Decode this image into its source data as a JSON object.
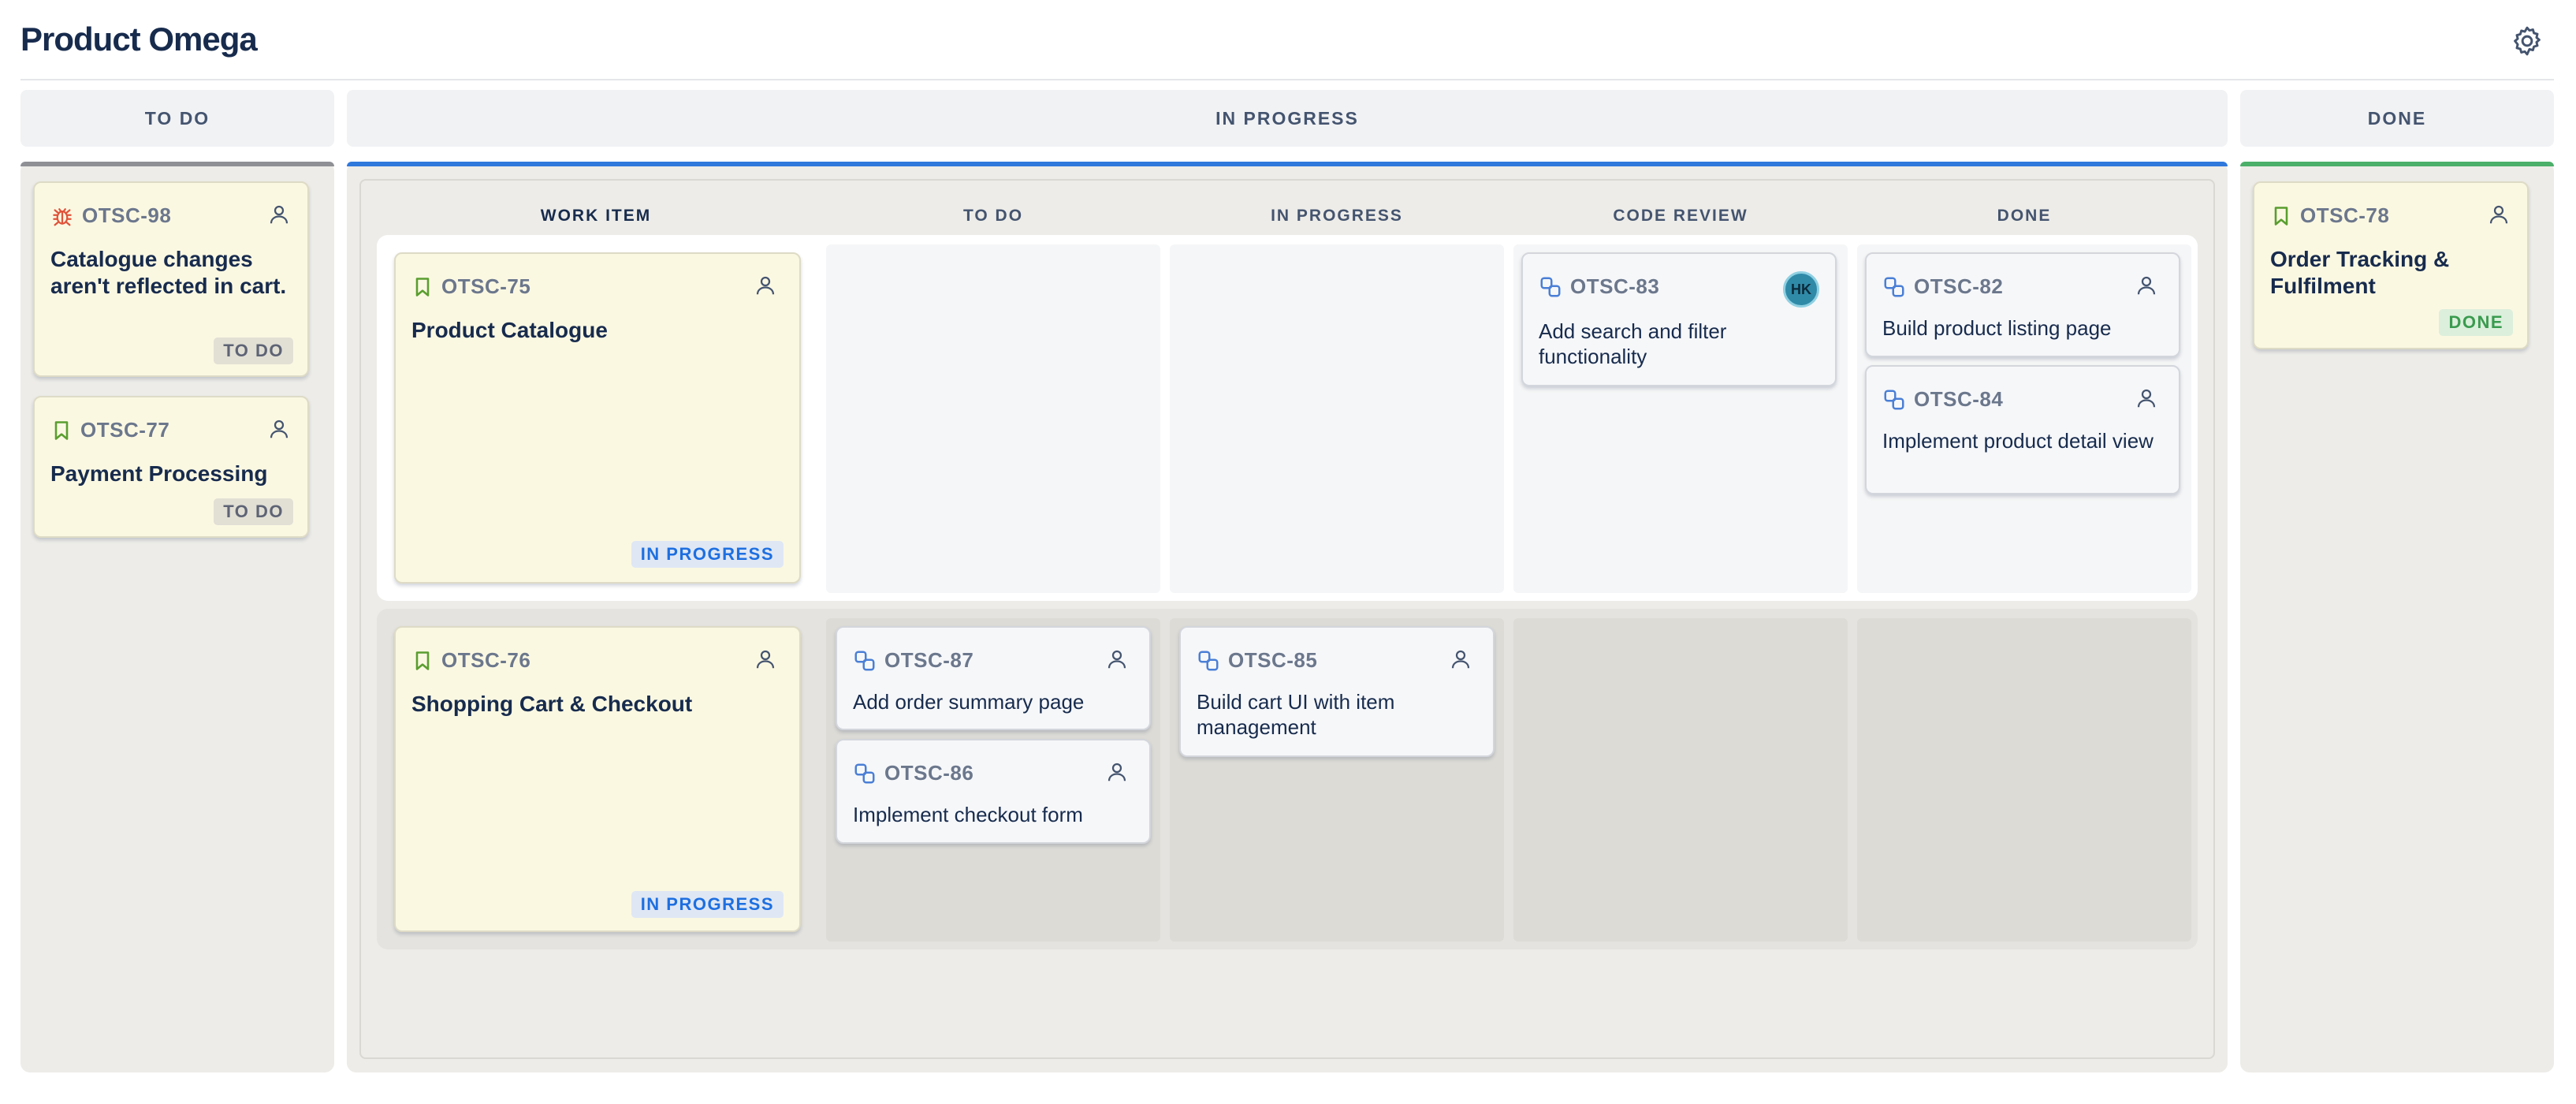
{
  "header": {
    "project_title": "Product Omega",
    "settings_icon": "gear-icon"
  },
  "columns": {
    "todo": {
      "label": "TO DO",
      "accent": "#8f9096"
    },
    "in_progress": {
      "label": "IN PROGRESS",
      "accent": "#2f78dc"
    },
    "done": {
      "label": "DONE",
      "accent": "#4caf6a"
    }
  },
  "sub_columns": [
    "WORK ITEM",
    "TO DO",
    "IN PROGRESS",
    "CODE REVIEW",
    "DONE"
  ],
  "todo_cards": [
    {
      "key": "OTSC-98",
      "type_icon": "bug-icon",
      "title": "Catalogue changes aren't reflected in cart.",
      "status": "TO DO"
    },
    {
      "key": "OTSC-77",
      "type_icon": "bookmark-icon",
      "title": "Payment Processing",
      "status": "TO DO"
    }
  ],
  "swimlanes": [
    {
      "parent": {
        "key": "OTSC-75",
        "type_icon": "bookmark-icon",
        "title": "Product Catalogue",
        "status": "IN PROGRESS"
      },
      "code_review": [
        {
          "key": "OTSC-83",
          "title": "Add search and filter functionality",
          "assignee": "HK"
        }
      ],
      "done": [
        {
          "key": "OTSC-82",
          "title": "Build product listing page"
        },
        {
          "key": "OTSC-84",
          "title": "Implement product detail view"
        }
      ]
    },
    {
      "parent": {
        "key": "OTSC-76",
        "type_icon": "bookmark-icon",
        "title": "Shopping Cart & Checkout",
        "status": "IN PROGRESS"
      },
      "todo": [
        {
          "key": "OTSC-87",
          "title": "Add order summary page"
        },
        {
          "key": "OTSC-86",
          "title": "Implement checkout form"
        }
      ],
      "in_progress": [
        {
          "key": "OTSC-85",
          "title": "Build cart UI with item management"
        }
      ]
    }
  ],
  "done_cards": [
    {
      "key": "OTSC-78",
      "type_icon": "bookmark-icon",
      "title": "Order Tracking & Fulfilment",
      "status": "DONE"
    }
  ],
  "colors": {
    "story": "#5a9e2f",
    "bug": "#e0533a",
    "subtask": "#4a7fd6",
    "card_yellow": "#fbf8e2",
    "card_white": "#f6f7f9"
  }
}
